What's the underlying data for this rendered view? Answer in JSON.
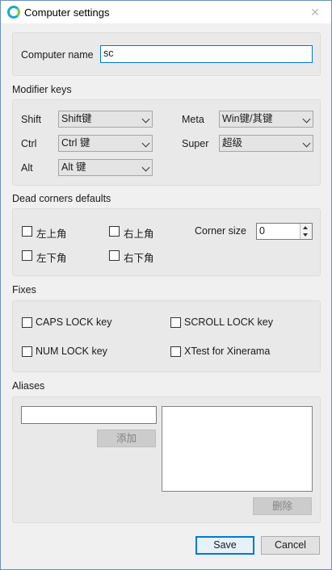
{
  "window": {
    "title": "Computer settings",
    "close_glyph": "✕"
  },
  "computer_name": {
    "label": "Computer name",
    "value": "sc"
  },
  "modifier_keys": {
    "title": "Modifier keys",
    "shift": {
      "label": "Shift",
      "value": "Shift键"
    },
    "ctrl": {
      "label": "Ctrl",
      "value": "Ctrl 键"
    },
    "alt": {
      "label": "Alt",
      "value": "Alt 键"
    },
    "meta": {
      "label": "Meta",
      "value": "Win键/其键"
    },
    "super": {
      "label": "Super",
      "value": "超级"
    }
  },
  "dead_corners": {
    "title": "Dead corners defaults",
    "top_left": "左上角",
    "top_right": "右上角",
    "bottom_left": "左下角",
    "bottom_right": "右下角",
    "corner_size_label": "Corner size",
    "corner_size_value": "0"
  },
  "fixes": {
    "title": "Fixes",
    "caps_lock": "CAPS LOCK key",
    "scroll_lock": "SCROLL LOCK key",
    "num_lock": "NUM LOCK key",
    "xtest": "XTest for Xinerama"
  },
  "aliases": {
    "title": "Aliases",
    "input_value": "",
    "add_label": "添加",
    "remove_label": "删除"
  },
  "buttons": {
    "save": "Save",
    "cancel": "Cancel"
  },
  "icons": {
    "app": "synergy-icon",
    "close": "close-icon",
    "chevron": "chevron-down-icon"
  },
  "colors": {
    "accent": "#0078d7",
    "window_border": "#6a8fbf"
  }
}
